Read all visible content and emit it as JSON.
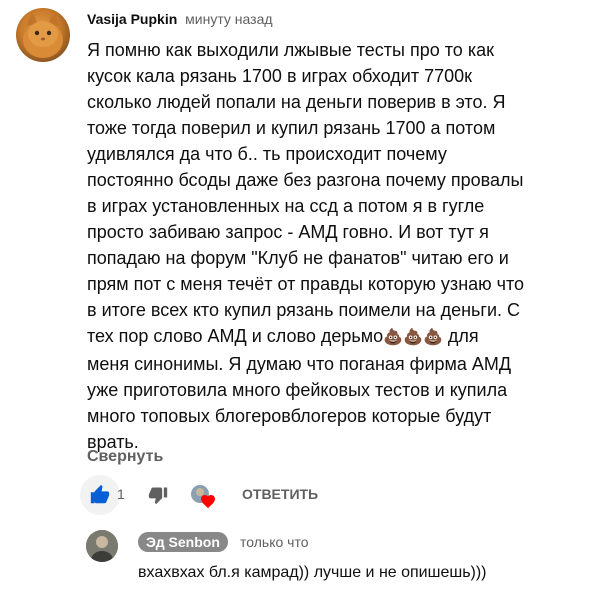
{
  "comment": {
    "author": "Vasija Pupkin",
    "time": "минуту назад",
    "text_main": "Я помню как выходили лжывые тесты про то как\nкусок кала рязань 1700 в играх обходит 7700к\nсколько людей попали на деньги поверив в это. Я\nтоже тогда поверил и купил рязань 1700 а потом\nудивлялся да что б.. ть происходит почему\nпостоянно бсоды даже без разгона почему провалы\nв играх установленных на ссд а потом я в гугле\nпросто забиваю запрос - АМД говно. И вот тут я\nпопадаю на форум \"Клуб не фанатов\" читаю его и\nпрям пот с меня течёт от правды которую узнаю что\nв итоге всех кто купил рязань поимели на деньги. С\nтех пор слово АМД и слово дерьмо",
    "emojis": "💩💩💩",
    "text_after_emoji": " для\nменя синонимы. Я думаю что поганая фирма АМД\nуже приготовила много фейковых тестов и купила\nмного топовых блогеровблогеров которые будут\nврать.",
    "collapse_label": "Свернуть",
    "like_count": "1",
    "reply_label": "ОТВЕТИТЬ"
  },
  "reply": {
    "author": "Эд Senbon",
    "time": "только что",
    "text": "вхахвхах бл.я камрад)) лучше и не опишешь)))"
  },
  "colors": {
    "accent_like": "#065fd4",
    "heart": "#ff0000",
    "secondary_text": "#606060"
  },
  "icons": [
    "thumb-up-icon",
    "thumb-down-icon",
    "heart-icon"
  ]
}
